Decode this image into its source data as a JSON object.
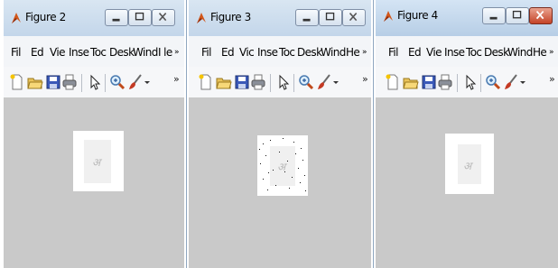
{
  "windows": [
    {
      "title": "Figure 2",
      "title_style": "light",
      "menu": [
        "Fil",
        "Ed",
        "Vie",
        "Inse",
        "Toc",
        "Desk",
        "Wind",
        "I le",
        "»"
      ],
      "overflow": "»"
    },
    {
      "title": "Figure 3",
      "title_style": "light",
      "menu": [
        "Fil",
        "Ed",
        "Vic",
        "Inse",
        "Toc",
        "Desk",
        "Wind",
        "He",
        "»"
      ],
      "overflow": "»"
    },
    {
      "title": "Figure 4",
      "title_style": "active",
      "menu": [
        "Fil",
        "Ed",
        "Vie",
        "Inse",
        "Toc",
        "Desk",
        "Wind",
        "He",
        "»"
      ],
      "overflow": "»"
    }
  ],
  "icons": {
    "window": [
      "matlab-logo-icon",
      "minimize-icon",
      "maximize-icon",
      "close-icon"
    ],
    "toolbar": [
      "new-file-icon",
      "open-folder-icon",
      "save-icon",
      "print-icon",
      "pointer-icon",
      "zoom-in-icon",
      "brush-icon",
      "dropdown-arrow-icon",
      "overflow-icon"
    ]
  },
  "image_glyph": "अ",
  "colors": {
    "plot_background": "#c9c9c9",
    "image_background": "#ffffff",
    "close_active": "#c54327"
  }
}
